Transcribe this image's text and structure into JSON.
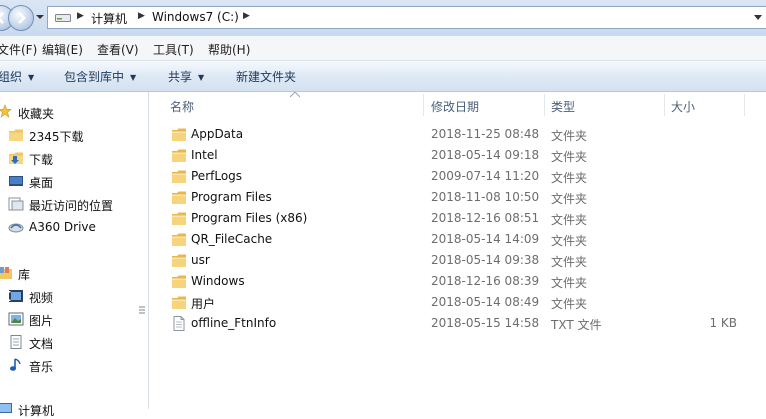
{
  "address": {
    "crumbs": [
      "计算机",
      "Windows7 (C:)"
    ]
  },
  "menu": [
    "文件(F)",
    "编辑(E)",
    "查看(V)",
    "工具(T)",
    "帮助(H)"
  ],
  "commands": {
    "organize": "组织",
    "include_library": "包含到库中",
    "share": "共享",
    "new_folder": "新建文件夹"
  },
  "nav": {
    "favorites": {
      "label": "收藏夹",
      "items": [
        "2345下载",
        "下载",
        "桌面",
        "最近访问的位置",
        "A360 Drive"
      ]
    },
    "libraries": {
      "label": "库",
      "items": [
        "视频",
        "图片",
        "文档",
        "音乐"
      ]
    },
    "computer_label": "计算机"
  },
  "columns": {
    "name": "名称",
    "modified": "修改日期",
    "type": "类型",
    "size": "大小"
  },
  "files": [
    {
      "name": "AppData",
      "modified": "2018-11-25 08:48",
      "type": "文件夹",
      "size": "",
      "icon": "folder-icon"
    },
    {
      "name": "Intel",
      "modified": "2018-05-14 09:18",
      "type": "文件夹",
      "size": "",
      "icon": "folder-icon"
    },
    {
      "name": "PerfLogs",
      "modified": "2009-07-14 11:20",
      "type": "文件夹",
      "size": "",
      "icon": "folder-icon"
    },
    {
      "name": "Program Files",
      "modified": "2018-11-08 10:50",
      "type": "文件夹",
      "size": "",
      "icon": "folder-icon"
    },
    {
      "name": "Program Files (x86)",
      "modified": "2018-12-16 08:51",
      "type": "文件夹",
      "size": "",
      "icon": "folder-icon"
    },
    {
      "name": "QR_FileCache",
      "modified": "2018-05-14 14:09",
      "type": "文件夹",
      "size": "",
      "icon": "folder-icon"
    },
    {
      "name": "usr",
      "modified": "2018-05-14 09:38",
      "type": "文件夹",
      "size": "",
      "icon": "folder-icon"
    },
    {
      "name": "Windows",
      "modified": "2018-12-16 08:39",
      "type": "文件夹",
      "size": "",
      "icon": "folder-icon"
    },
    {
      "name": "用户",
      "modified": "2018-05-14 08:49",
      "type": "文件夹",
      "size": "",
      "icon": "folder-icon"
    },
    {
      "name": "offline_FtnInfo",
      "modified": "2018-05-15 14:58",
      "type": "TXT 文件",
      "size": "1 KB",
      "icon": "text-file-icon"
    }
  ]
}
